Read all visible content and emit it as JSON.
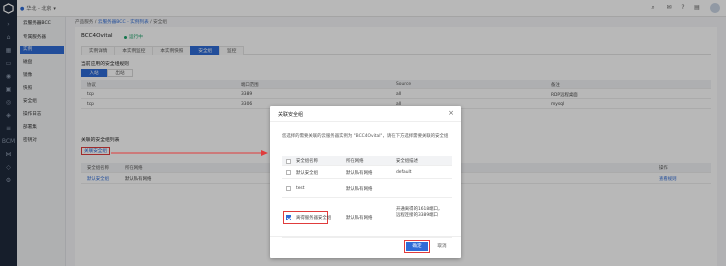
{
  "topbar": {
    "region": "华北 - 北京",
    "icons": [
      "search-icon",
      "mail-icon",
      "help-icon",
      "book-icon",
      "user-icon"
    ]
  },
  "rail": {
    "icons": [
      "chevron-right-icon",
      "home-icon",
      "grid-icon",
      "server-icon",
      "disk-icon",
      "image-icon",
      "camera-icon",
      "security-icon",
      "log-icon",
      "settings-icon",
      "bcm-icon",
      "network-icon",
      "tag-icon"
    ],
    "bottom_label": "BCM"
  },
  "subnav": {
    "title": "云服务器BCC",
    "items": [
      {
        "label": "专属服务器"
      },
      {
        "label": "实例"
      },
      {
        "label": "磁盘"
      },
      {
        "label": "镜像"
      },
      {
        "label": "快照"
      },
      {
        "label": "安全组"
      },
      {
        "label": "操作日志"
      },
      {
        "label": "部署集"
      },
      {
        "label": "密钥对"
      }
    ]
  },
  "breadcrumb": {
    "root": "产品服务",
    "sep1": " / ",
    "l1": "云服务器BCC - 实例列表",
    "sep2": " / ",
    "current": "安全组"
  },
  "instance": {
    "name": "BCC4Ovital",
    "status": "运行中"
  },
  "tabs": [
    {
      "label": "实例详情"
    },
    {
      "label": "本实例监控"
    },
    {
      "label": "本实例快照"
    },
    {
      "label": "安全组"
    },
    {
      "label": "监控"
    }
  ],
  "rules": {
    "title": "当前应用的安全组规则",
    "dir_in": "入站",
    "dir_out": "出站",
    "headers": [
      "协议",
      "端口范围",
      "Source",
      "备注"
    ],
    "rows": [
      [
        "tcp",
        "3389",
        "all",
        "RDP远程桌面"
      ],
      [
        "tcp",
        "3306",
        "all",
        "mysql"
      ]
    ]
  },
  "bound": {
    "title": "关联的安全组列表",
    "bind_label": "关联安全组",
    "headers": [
      "安全组名称",
      "所在网络",
      "操作"
    ],
    "rows": [
      {
        "name": "默认安全组",
        "net": "默认私有网络",
        "action": "查看规则"
      }
    ]
  },
  "dialog": {
    "title": "关联安全组",
    "desc": "您选择的需要关联的云服务器实例为 \"BCC4Ovital\"，请在下方选择需要关联的安全组",
    "headers": [
      "安全组名称",
      "所在网络",
      "安全组描述"
    ],
    "rows": [
      {
        "name": "默认安全组",
        "net": "默认私有网络",
        "desc": "default",
        "checked": false
      },
      {
        "name": "test",
        "net": "默认私有网络",
        "desc": "",
        "checked": false
      },
      {
        "name": "离得服务器安全组",
        "net": "默认私有网络",
        "desc": "开通离得的1618端口，远程连接的3389端口",
        "checked": true
      }
    ],
    "confirm": "确定",
    "cancel": "取消"
  },
  "colors": {
    "accent": "#2e6bd6",
    "highlight": "#e03c3c",
    "rail": "#1f2a3c"
  }
}
